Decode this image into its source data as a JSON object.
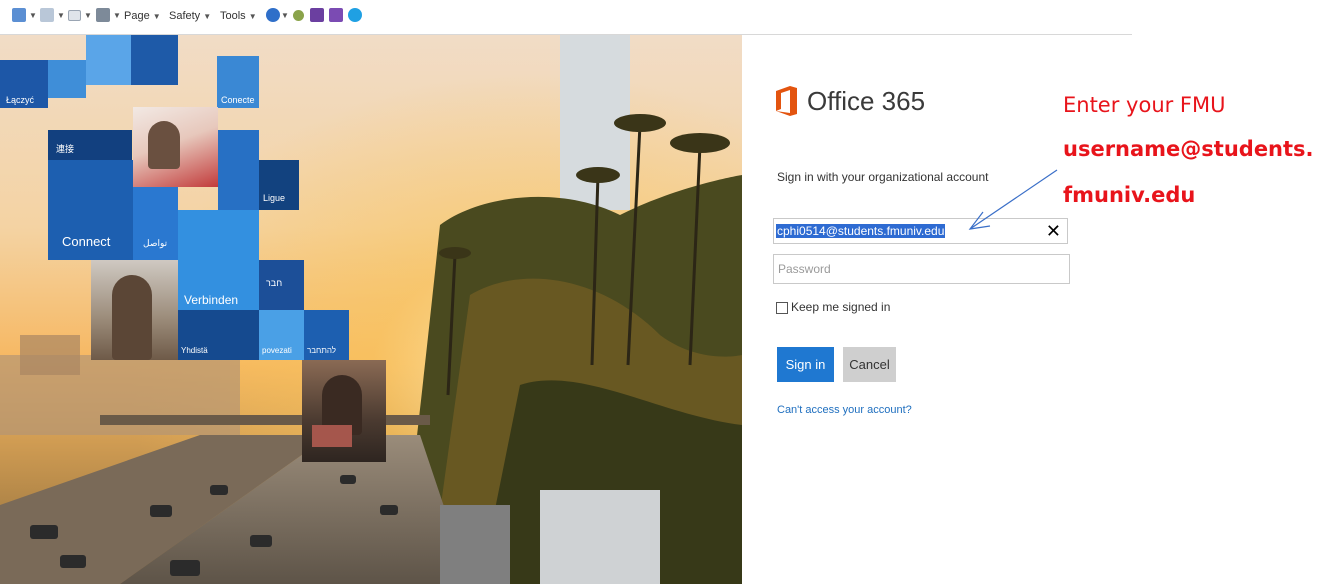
{
  "toolbar": {
    "page_label": "Page",
    "safety_label": "Safety",
    "tools_label": "Tools"
  },
  "tiles": {
    "lacz": "Łączyć",
    "conecte": "Conecte",
    "cjk": "連接",
    "ligue": "Ligue",
    "connect": "Connect",
    "arabic": "تواصل",
    "verbinden": "Verbinden",
    "hebrew": "חבר",
    "yhdista": "Yhdistä",
    "povezati": "povezati",
    "hebrew2": "להתחבר"
  },
  "signin": {
    "logo_text": "Office 365",
    "heading": "Sign in with your organizational account",
    "username_value": "cphi0514@students.fmuniv.edu",
    "clear_glyph": "✕",
    "password_placeholder": "Password",
    "keep_signed_in": "Keep me signed in",
    "signin_label": "Sign in",
    "cancel_label": "Cancel",
    "cant_access": "Can't access your account?"
  },
  "annotation": {
    "line1": "Enter your FMU",
    "line2": "username@students.",
    "line3": "fmuniv.edu"
  },
  "colors": {
    "office_orange": "#e3540f",
    "annotation_red": "#e8141b",
    "signin_blue": "#1f78d1",
    "tile_blue": "#1e5aa8"
  }
}
